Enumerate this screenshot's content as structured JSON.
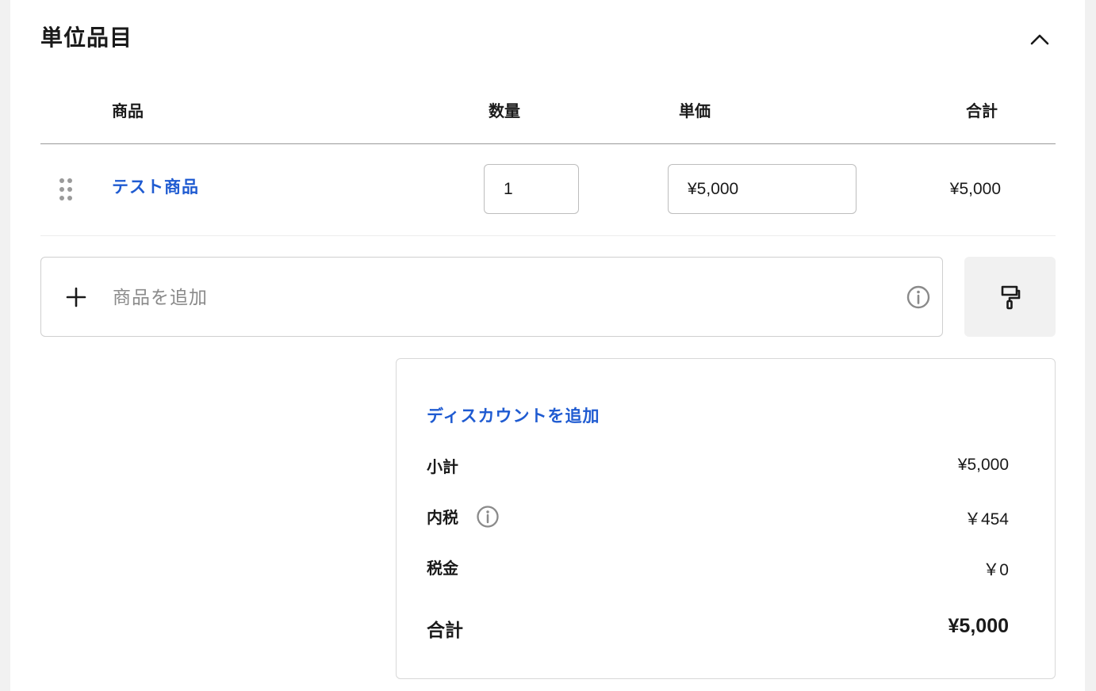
{
  "section": {
    "title": "単位品目",
    "collapse_icon": "chevron-up-icon"
  },
  "table": {
    "headers": {
      "product": "商品",
      "quantity": "数量",
      "unit_price": "単価",
      "total": "合計"
    },
    "rows": [
      {
        "product": "テスト商品",
        "quantity": "1",
        "unit_price": "¥5,000",
        "total": "¥5,000"
      }
    ]
  },
  "add_item": {
    "placeholder": "商品を追加",
    "icon": "plus-icon",
    "info_icon": "info-icon",
    "side_button_icon": "paint-roller-icon"
  },
  "summary": {
    "discount_link": "ディスカウントを追加",
    "subtotal_label": "小計",
    "subtotal_value": "¥5,000",
    "included_tax_label": "内税",
    "included_tax_value": "￥454",
    "tax_label": "税金",
    "tax_value": "￥0",
    "total_label": "合計",
    "total_value": "¥5,000"
  },
  "colors": {
    "link": "#1f5bd1",
    "page_bg": "#f1f1f1"
  }
}
